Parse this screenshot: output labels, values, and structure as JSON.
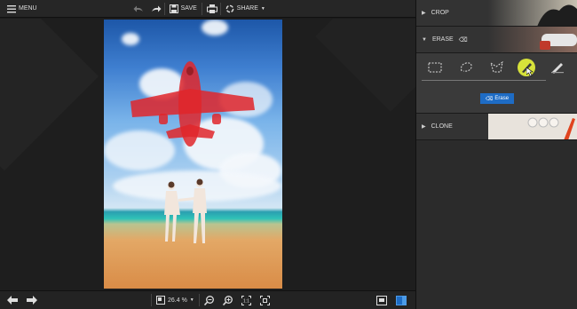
{
  "toolbar": {
    "menu_label": "MENU",
    "save_label": "SAVE",
    "share_label": "SHARE"
  },
  "sidebar": {
    "crop_label": "CROP",
    "erase_label": "ERASE",
    "erase_button_label": "Erase",
    "clone_label": "CLONE",
    "tools": [
      "rectangle-select",
      "lasso-select",
      "polygon-select",
      "brush",
      "eraser-brush"
    ],
    "active_tool": "brush"
  },
  "bottombar": {
    "zoom_value": "26.4 %"
  },
  "colors": {
    "accent": "#1e6cc5",
    "selection_mask": "#e0262a",
    "brush_highlight": "#d7e23a"
  }
}
